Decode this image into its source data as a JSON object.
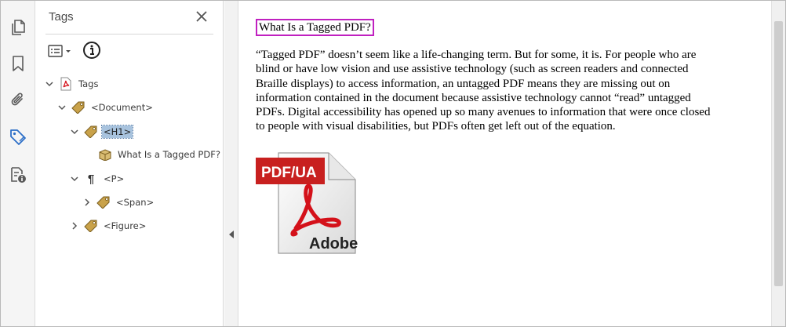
{
  "rail": {
    "tools": [
      {
        "icon": "pages-icon"
      },
      {
        "icon": "bookmark-icon"
      },
      {
        "icon": "attachment-icon"
      },
      {
        "icon": "tags-icon",
        "active": true
      },
      {
        "icon": "order-icon"
      }
    ]
  },
  "panel": {
    "title": "Tags",
    "tree": [
      {
        "label": "Tags",
        "icon": "pdf-file-icon",
        "expanded": true
      },
      {
        "label": "<Document>",
        "icon": "tag-icon",
        "expanded": true
      },
      {
        "label": "<H1>",
        "icon": "tag-icon",
        "expanded": true,
        "selected": true
      },
      {
        "label": "What Is a Tagged PDF?",
        "icon": "content-box-icon"
      },
      {
        "label": "<P>",
        "icon": "pilcrow-icon",
        "expanded": true
      },
      {
        "label": "<Span>",
        "icon": "tag-icon",
        "expanded": false
      },
      {
        "label": "<Figure>",
        "icon": "tag-icon",
        "expanded": false
      }
    ]
  },
  "document": {
    "heading": "What Is a Tagged PDF?",
    "paragraph_lines": [
      "“Tagged PDF” doesn’t seem like a life-changing term. But for some, it is. For people who are",
      "blind or have low vision and use assistive technology (such as screen readers and connected",
      "Braille displays) to access information, an untagged PDF means they are missing out on",
      "information contained in the document because assistive technology cannot “read” untagged",
      "PDFs.  Digital accessibility has opened up so many avenues to information that were once closed",
      "to people with visual disabilities, but PDFs often get left out of the equation."
    ],
    "figure": {
      "banner": "PDF/UA",
      "brand": "Adobe",
      "banner_color": "#c8201f",
      "logo_color": "#d4111a"
    }
  },
  "colors": {
    "heading_highlight": "#c020c0",
    "selection": "#a8c3de",
    "tag_icon": "#c9a24a"
  }
}
